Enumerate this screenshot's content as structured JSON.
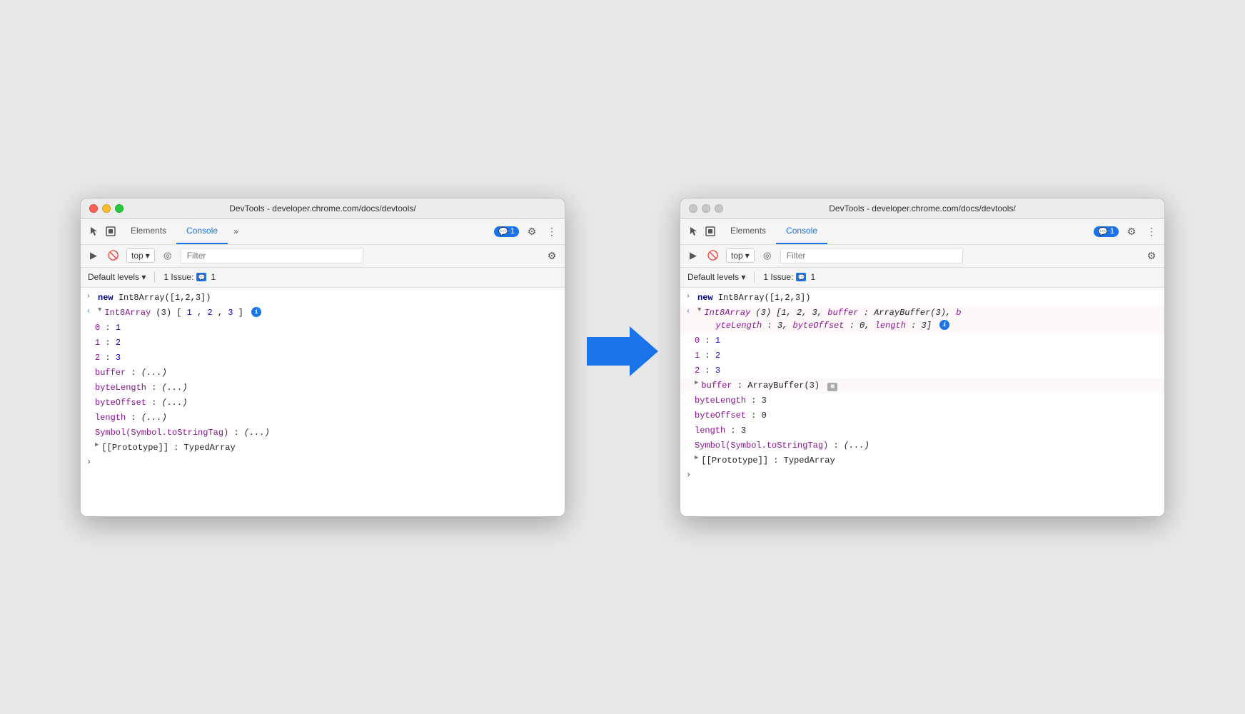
{
  "scene": {
    "arrow_label": "→"
  },
  "left_window": {
    "title": "DevTools - developer.chrome.com/docs/devtools/",
    "traffic_lights": [
      "red",
      "yellow",
      "green"
    ],
    "tabs": [
      {
        "label": "Elements",
        "active": false
      },
      {
        "label": "Console",
        "active": true
      }
    ],
    "tab_more": "»",
    "badge": {
      "icon": "💬",
      "count": "1"
    },
    "console_toolbar": {
      "top_label": "top",
      "filter_placeholder": "Filter"
    },
    "issues_bar": {
      "default_levels": "Default levels ▾",
      "issues_label": "1 Issue:",
      "issues_count": "1"
    },
    "console_lines": [
      {
        "type": "input",
        "content": "new Int8Array([1,2,3])"
      },
      {
        "type": "expanded_header",
        "content": "Int8Array(3) [1, 2, 3]",
        "has_info": true
      },
      {
        "type": "prop",
        "indent": 2,
        "key": "0",
        "value": "1"
      },
      {
        "type": "prop",
        "indent": 2,
        "key": "1",
        "value": "2"
      },
      {
        "type": "prop",
        "indent": 2,
        "key": "2",
        "value": "3"
      },
      {
        "type": "prop_lazy",
        "indent": 2,
        "key": "buffer",
        "value": "(...)"
      },
      {
        "type": "prop_lazy",
        "indent": 2,
        "key": "byteLength",
        "value": "(...)"
      },
      {
        "type": "prop_lazy",
        "indent": 2,
        "key": "byteOffset",
        "value": "(...)"
      },
      {
        "type": "prop_lazy",
        "indent": 2,
        "key": "length",
        "value": "(...)"
      },
      {
        "type": "prop_lazy",
        "indent": 2,
        "key": "Symbol(Symbol.toStringTag)",
        "value": "(...)"
      },
      {
        "type": "prototype",
        "indent": 2,
        "value": "[[Prototype]]: TypedArray"
      }
    ]
  },
  "right_window": {
    "title": "DevTools - developer.chrome.com/docs/devtools/",
    "traffic_lights": [
      "inactive",
      "inactive",
      "inactive"
    ],
    "tabs": [
      {
        "label": "Elements",
        "active": false
      },
      {
        "label": "Console",
        "active": true
      }
    ],
    "tab_more": "»",
    "badge": {
      "icon": "💬",
      "count": "1"
    },
    "console_toolbar": {
      "top_label": "top",
      "filter_placeholder": "Filter"
    },
    "issues_bar": {
      "default_levels": "Default levels ▾",
      "issues_label": "1 Issue:",
      "issues_count": "1"
    },
    "console_lines": [
      {
        "type": "input",
        "content": "new Int8Array([1,2,3])"
      },
      {
        "type": "expanded_header_long",
        "content": "Int8Array(3) [1, 2, 3, buffer: ArrayBuffer(3), byteLength: 3, byteOffset: 0, length: 3]",
        "has_info": true,
        "has_red_arrow": true
      },
      {
        "type": "prop",
        "indent": 2,
        "key": "0",
        "value": "1"
      },
      {
        "type": "prop",
        "indent": 2,
        "key": "1",
        "value": "2"
      },
      {
        "type": "prop",
        "indent": 2,
        "key": "2",
        "value": "3"
      },
      {
        "type": "prop_expanded",
        "indent": 2,
        "key": "buffer",
        "value": "ArrayBuffer(3)",
        "has_icon": true,
        "has_red_arrow": true
      },
      {
        "type": "prop_value",
        "indent": 2,
        "key": "byteLength",
        "value": "3"
      },
      {
        "type": "prop_value",
        "indent": 2,
        "key": "byteOffset",
        "value": "0"
      },
      {
        "type": "prop_value",
        "indent": 2,
        "key": "length",
        "value": "3"
      },
      {
        "type": "prop_lazy",
        "indent": 2,
        "key": "Symbol(Symbol.toStringTag)",
        "value": "(...)"
      },
      {
        "type": "prototype",
        "indent": 2,
        "value": "[[Prototype]]: TypedArray"
      }
    ]
  }
}
